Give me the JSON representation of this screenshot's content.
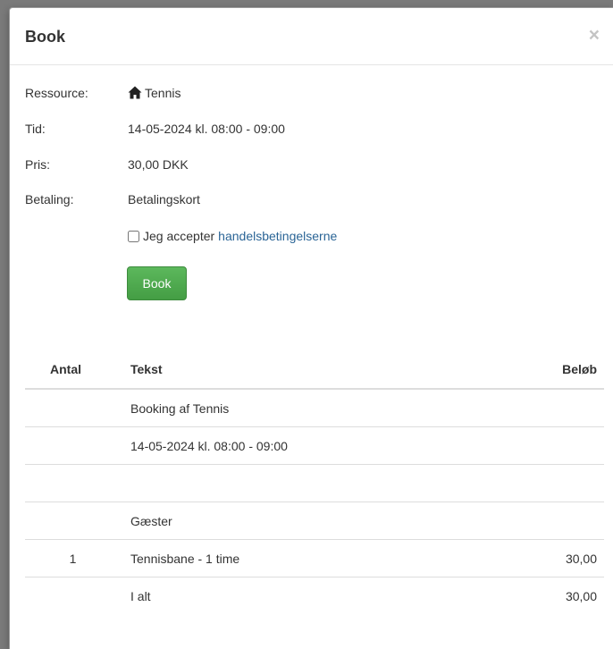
{
  "modal": {
    "title": "Book",
    "close_icon": "close-icon",
    "close_symbol": "×"
  },
  "details": {
    "resource_label": "Ressource:",
    "resource_icon": "home-icon",
    "resource_value": "Tennis",
    "time_label": "Tid:",
    "time_value": "14-05-2024 kl. 08:00 - 09:00",
    "price_label": "Pris:",
    "price_value": "30,00 DKK",
    "payment_label": "Betaling:",
    "payment_value": "Betalingskort"
  },
  "terms": {
    "checked": false,
    "text": "Jeg accepter",
    "link_text": "handelsbetingelserne"
  },
  "book_button": "Book",
  "table": {
    "headers": {
      "antal": "Antal",
      "tekst": "Tekst",
      "belob": "Beløb"
    },
    "rows": [
      {
        "antal": "",
        "tekst": "Booking af Tennis",
        "belob": ""
      },
      {
        "antal": "",
        "tekst": "14-05-2024 kl. 08:00 - 09:00",
        "belob": ""
      },
      {
        "antal": "",
        "tekst": "",
        "belob": ""
      },
      {
        "antal": "",
        "tekst": "Gæster",
        "belob": ""
      },
      {
        "antal": "1",
        "tekst": "Tennisbane - 1 time",
        "belob": "30,00"
      },
      {
        "antal": "",
        "tekst": "I alt",
        "belob": "30,00"
      }
    ]
  },
  "colors": {
    "primary_button": "#5cb85c",
    "link": "#2a6496"
  }
}
